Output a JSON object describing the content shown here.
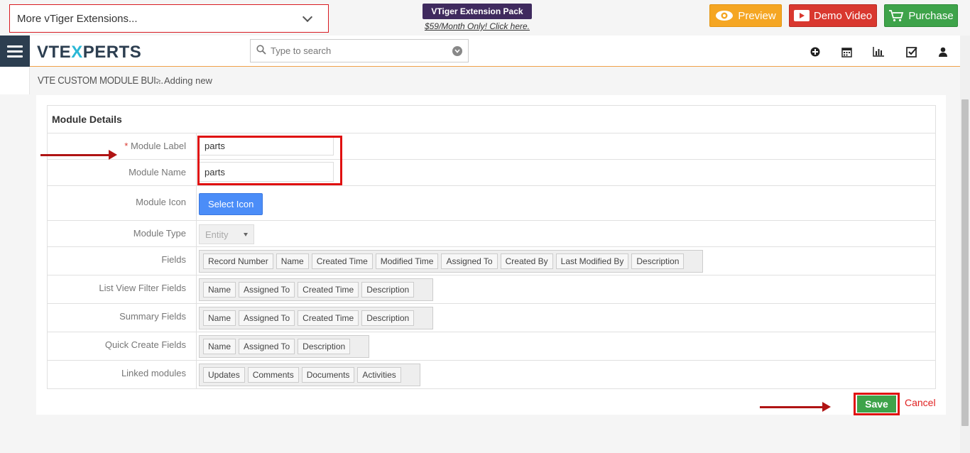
{
  "promo": {
    "extensions_select": "More vTiger Extensions...",
    "pack_badge": "VTiger Extension Pack",
    "pack_link": "$59/Month Only! Click here.",
    "preview": "Preview",
    "demo_video": "Demo Video",
    "purchase": "Purchase"
  },
  "header": {
    "logo_a": "VTE",
    "logo_x": "X",
    "logo_b": "PERTS",
    "search_placeholder": "Type to search"
  },
  "breadcrumb": {
    "module": "VTE CUSTOM MODULE BUI...",
    "separator": ">",
    "current": "Adding new"
  },
  "form": {
    "section_title": "Module Details",
    "required_mark": "*",
    "module_label_label": "Module Label",
    "module_label_value": "parts",
    "module_name_label": "Module Name",
    "module_name_value": "parts",
    "module_icon_label": "Module Icon",
    "select_icon": "Select Icon",
    "module_type_label": "Module Type",
    "module_type_value": "Entity",
    "fields_label": "Fields",
    "fields": [
      "Record Number",
      "Name",
      "Created Time",
      "Modified Time",
      "Assigned To",
      "Created By",
      "Last Modified By",
      "Description"
    ],
    "list_view_label": "List View Filter Fields",
    "list_view_fields": [
      "Name",
      "Assigned To",
      "Created Time",
      "Description"
    ],
    "summary_label": "Summary Fields",
    "summary_fields": [
      "Name",
      "Assigned To",
      "Created Time",
      "Description"
    ],
    "quick_create_label": "Quick Create Fields",
    "quick_create_fields": [
      "Name",
      "Assigned To",
      "Description"
    ],
    "linked_label": "Linked modules",
    "linked_modules": [
      "Updates",
      "Comments",
      "Documents",
      "Activities"
    ]
  },
  "actions": {
    "save": "Save",
    "cancel": "Cancel"
  },
  "colors": {
    "annotation_red": "#e01010",
    "save_green": "#3ea34a",
    "select_icon_blue": "#4b8df8"
  }
}
